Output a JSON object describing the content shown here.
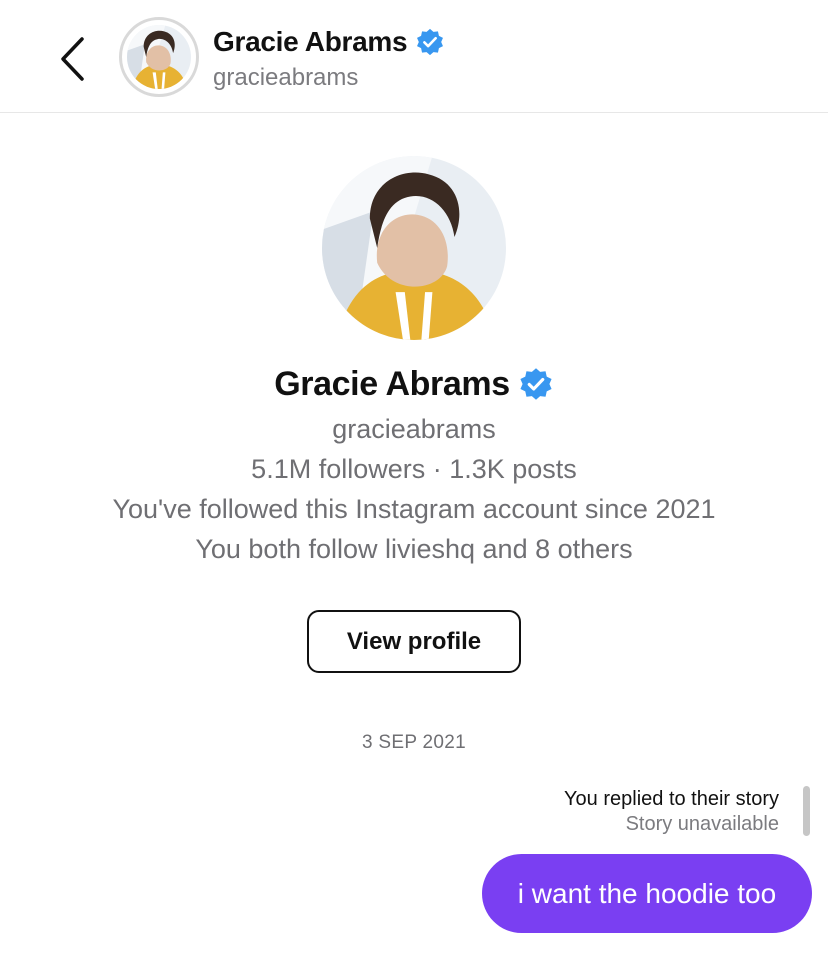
{
  "header": {
    "display_name": "Gracie Abrams",
    "username": "gracieabrams"
  },
  "profile": {
    "display_name": "Gracie Abrams",
    "username": "gracieabrams",
    "stats": "5.1M followers · 1.3K posts",
    "followed_since": "You've followed this Instagram account since 2021",
    "mutuals": "You both follow livieshq and 8 others",
    "view_profile_label": "View profile"
  },
  "conversation": {
    "date": "3 SEP 2021",
    "reply_title": "You replied to their story",
    "reply_status": "Story unavailable",
    "message_text": "i want the hoodie too"
  },
  "colors": {
    "accent_purple": "#7a3ff2",
    "verified_blue": "#3897f0",
    "secondary_text": "#6f6f73"
  },
  "icons": {
    "back": "chevron-left-icon",
    "verified": "verified-badge-icon"
  }
}
